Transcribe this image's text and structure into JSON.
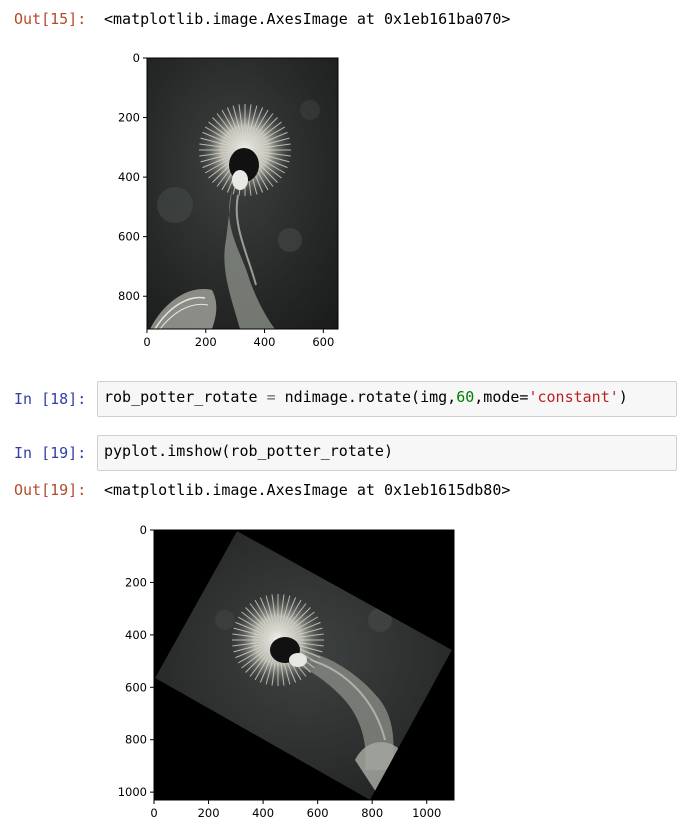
{
  "cells": [
    {
      "type": "output",
      "prompt": "Out[15]:",
      "text": "<matplotlib.image.AxesImage at 0x1eb161ba070>"
    },
    {
      "type": "input",
      "prompt": "In [18]:",
      "code_parts": [
        "rob_potter_rotate ",
        "=",
        " ndimage.rotate(img,",
        "60",
        ",mode=",
        "'constant'",
        ")"
      ]
    },
    {
      "type": "input",
      "prompt": "In [19]:",
      "code_parts": [
        "pyplot.imshow(rob_potter_rotate)"
      ]
    },
    {
      "type": "output",
      "prompt": "Out[19]:",
      "text": "<matplotlib.image.AxesImage at 0x1eb1615db80>"
    }
  ],
  "chart_data": [
    {
      "type": "image",
      "description_of_axes": "matplotlib imshow of original image",
      "x_ticks": [
        "0",
        "200",
        "400",
        "600"
      ],
      "y_ticks": [
        "0",
        "200",
        "400",
        "600",
        "800"
      ],
      "xlim": [
        0,
        650
      ],
      "ylim": [
        910,
        0
      ]
    },
    {
      "type": "image",
      "description_of_axes": "matplotlib imshow of image rotated 60 degrees",
      "x_ticks": [
        "0",
        "200",
        "400",
        "600",
        "800",
        "1000"
      ],
      "y_ticks": [
        "0",
        "200",
        "400",
        "600",
        "800",
        "1000"
      ],
      "xlim": [
        0,
        1100
      ],
      "ylim": [
        1030,
        0
      ]
    }
  ],
  "colors": {
    "out_prompt": "#b34a2a",
    "in_prompt": "#2f3fa5",
    "string": "#ba2121",
    "number": "#008000"
  }
}
